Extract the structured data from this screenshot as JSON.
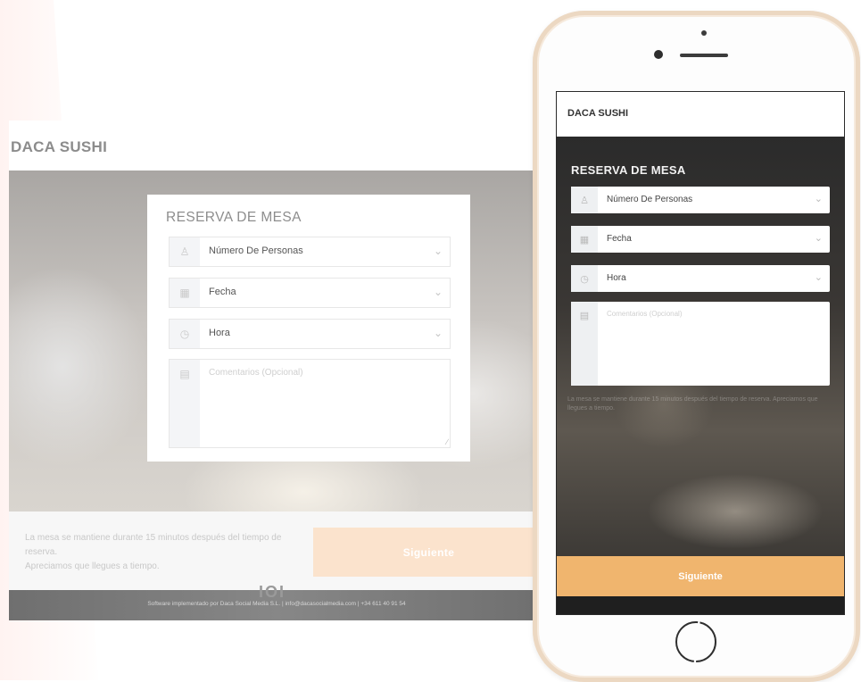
{
  "brand": "DACA SUSHI",
  "form": {
    "title": "RESERVA DE MESA",
    "fields": [
      {
        "label": "Número De Personas",
        "icon": "people-icon"
      },
      {
        "label": "Fecha",
        "icon": "calendar-icon"
      },
      {
        "label": "Hora",
        "icon": "clock-icon"
      }
    ],
    "comments_placeholder": "Comentarios (Opcional)",
    "comments_icon": "note-icon"
  },
  "notice_line1": "La mesa se mantiene durante 15 minutos después del tiempo de reserva.",
  "notice_line2": "Apreciamos que llegues a tiempo.",
  "next_label": "Siguiente",
  "footer": {
    "logo": "IOI",
    "text": "Software implementado por Daca Social Media S.L. | info@dacasocialmedia.com | +34 611 40 91 54"
  },
  "colors": {
    "accent": "#f0b56e",
    "accent_light": "#fbe3cd"
  }
}
